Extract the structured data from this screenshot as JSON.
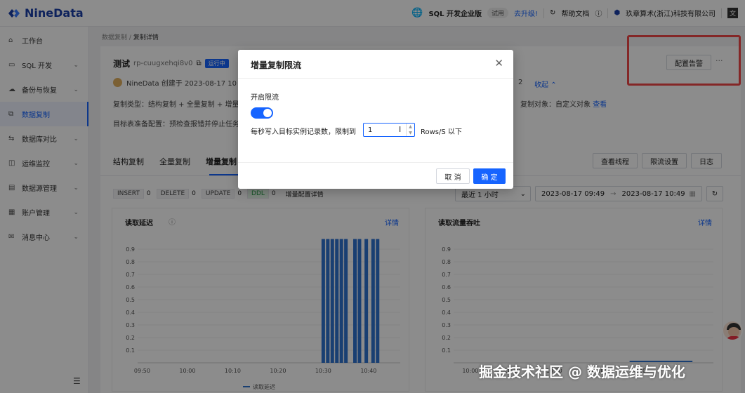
{
  "brand": {
    "name": "NineData"
  },
  "topbar": {
    "edition": "SQL 开发企业版",
    "trial_badge": "试用",
    "upgrade": "去升级!",
    "help": "帮助文档",
    "company": "玖章算术(浙江)科技有限公司"
  },
  "sidebar": {
    "items": [
      {
        "label": "工作台",
        "icon": "home-icon"
      },
      {
        "label": "SQL 开发",
        "icon": "terminal-icon"
      },
      {
        "label": "备份与恢复",
        "icon": "cloud-icon"
      },
      {
        "label": "数据复制",
        "icon": "copy-icon"
      },
      {
        "label": "数据库对比",
        "icon": "compare-icon"
      },
      {
        "label": "运维监控",
        "icon": "monitor-icon"
      },
      {
        "label": "数据源管理",
        "icon": "database-icon"
      },
      {
        "label": "账户管理",
        "icon": "account-icon"
      },
      {
        "label": "消息中心",
        "icon": "message-icon"
      }
    ],
    "active_index": 3
  },
  "breadcrumb": {
    "parent": "数据复制",
    "sep": "/",
    "current": "复制详情"
  },
  "task": {
    "name": "测试",
    "id": "rp-cuugxehqi8v0",
    "status": "运行中",
    "creator": "NineData 创建于 2023-08-17 10",
    "count_fragment": "2",
    "collapse": "收起",
    "type": "复制类型：结构复制 + 全量复制 + 增量",
    "target_prep": "目标表准备配置：预检查报错并停止任务",
    "object_label": "复制对象：自定义对象",
    "object_link": "查看"
  },
  "actions": {
    "alert": "配置告警",
    "more": "···"
  },
  "tabs": [
    "结构复制",
    "全量复制",
    "增量复制"
  ],
  "tab_buttons": {
    "threads": "查看线程",
    "throttle": "限流设置",
    "log": "日志"
  },
  "stats": {
    "insert_label": "INSERT",
    "insert": "0",
    "delete_label": "DELETE",
    "delete": "0",
    "update_label": "UPDATE",
    "update": "0",
    "ddl_label": "DDL",
    "ddl": "0",
    "detail": "增量配置详情"
  },
  "filter": {
    "range": "最近 1 小时",
    "start": "2023-08-17 09:49",
    "arrow": "→",
    "end": "2023-08-17 10:49"
  },
  "modal": {
    "title": "增量复制限流",
    "enable_label": "开启限流",
    "limit_prefix": "每秒写入目标实例记录数，限制到",
    "limit_value": "1",
    "limit_suffix": "Rows/S 以下",
    "cancel": "取 消",
    "ok": "确 定"
  },
  "watermark": "掘金技术社区 @ 数据运维与优化",
  "charts": {
    "latency_title": "读取延迟",
    "throughput_title": "读取流量吞吐",
    "detail_link": "详情"
  },
  "chart_data": [
    {
      "type": "bar",
      "title": "读取延迟",
      "y_ticks": [
        "0.1",
        "0.2",
        "0.3",
        "0.4",
        "0.5",
        "0.6",
        "0.7",
        "0.8",
        "0.9"
      ],
      "x_ticks": [
        "09:50",
        "10:00",
        "10:10",
        "10:20",
        "10:30",
        "10:40"
      ],
      "ylim": [
        0,
        1
      ],
      "legend": "读取延迟",
      "x_minutes": [
        40.0,
        41.0,
        42.0,
        43.0,
        44.0,
        45.0,
        47.0,
        48.0,
        49.5,
        51.0,
        52.0
      ],
      "values": [
        1,
        1,
        1,
        1,
        1,
        1,
        1,
        1,
        1,
        1,
        1
      ],
      "xlim": [
        -1,
        57
      ]
    },
    {
      "type": "line",
      "title": "读取流量吞吐",
      "y_ticks": [
        "0.1",
        "0.2",
        "0.3",
        "0.4",
        "0.5",
        "0.6",
        "0.7",
        "0.8",
        "0.9"
      ],
      "x_ticks": [
        "10:00",
        "10:10",
        "10:20",
        "10:30",
        "10:40"
      ],
      "ylim": [
        0,
        1
      ],
      "segment": {
        "x_start_min": 38,
        "x_end_min": 53,
        "value": 0.0
      }
    }
  ]
}
